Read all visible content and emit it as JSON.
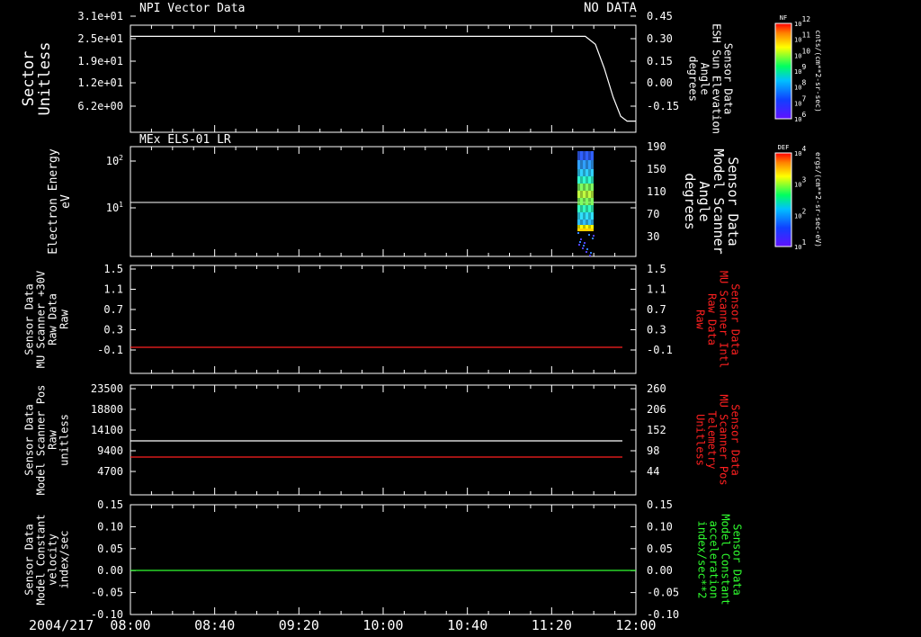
{
  "colors": {
    "bg": "#000000",
    "fg": "#ffffff",
    "red": "#ff2020",
    "green": "#30ff30"
  },
  "header": {
    "left": "NPI Vector Data",
    "right": "NO DATA"
  },
  "panels": [
    {
      "id": "p1",
      "title": "NPI Vector Data",
      "left_label": [
        "Sector",
        "Unitless"
      ],
      "right_label": [
        "Sensor Data",
        "ESH Sun Elevation",
        "Angle",
        "degrees"
      ],
      "right_color": "fg",
      "left_ticks": [
        "3.1e+01",
        "2.5e+01",
        "1.9e+01",
        "1.2e+01",
        "6.2e+00"
      ],
      "right_ticks": [
        "0.45",
        "0.30",
        "0.15",
        "0.00",
        "-0.15"
      ]
    },
    {
      "id": "p2",
      "title": "MEx ELS-01 LR",
      "left_label": [
        "Electron Energy",
        "eV"
      ],
      "right_label": [
        "Sensor Data",
        "Model Scanner",
        "Angle",
        "degrees"
      ],
      "right_color": "fg",
      "left_ticks": [
        "10^2",
        "10^1"
      ],
      "right_ticks": [
        "190",
        "150",
        "110",
        "70",
        "30"
      ]
    },
    {
      "id": "p3",
      "title": "",
      "left_label": [
        "Sensor Data",
        "MU Scanner +30V",
        "Raw Data",
        "Raw"
      ],
      "right_label": [
        "Sensor Data",
        "MU Scanner Intl",
        "Raw Data",
        "Raw"
      ],
      "right_color": "red",
      "left_ticks": [
        "1.5",
        "1.1",
        "0.7",
        "0.3",
        "-0.1"
      ],
      "right_ticks": [
        "1.5",
        "1.1",
        "0.7",
        "0.3",
        "-0.1"
      ]
    },
    {
      "id": "p4",
      "title": "",
      "left_label": [
        "Sensor Data",
        "Model Scanner Pos",
        "Raw",
        "unitless"
      ],
      "right_label": [
        "Sensor Data",
        "MU Scanner Pos",
        "Telemetry",
        "Unitless"
      ],
      "right_color": "red",
      "left_ticks": [
        "23500",
        "18800",
        "14100",
        "9400",
        "4700"
      ],
      "right_ticks": [
        "260",
        "206",
        "152",
        "98",
        "44"
      ]
    },
    {
      "id": "p5",
      "title": "",
      "left_label": [
        "Sensor Data",
        "Model Constant",
        "velocity",
        "index/sec"
      ],
      "right_label": [
        "Sensor Data",
        "Model Constant",
        "acceleration",
        "index/sec**2"
      ],
      "right_color": "green",
      "left_ticks": [
        "0.15",
        "0.10",
        "0.05",
        "0.00",
        "-0.05",
        "-0.10"
      ],
      "right_ticks": [
        "0.15",
        "0.10",
        "0.05",
        "0.00",
        "-0.05",
        "-0.10"
      ]
    }
  ],
  "colorbars": [
    {
      "tag": "NF",
      "units": "cnts/(cm**2-sr-sec)",
      "ticks": [
        "10^12",
        "10^11",
        "10^10",
        "10^9",
        "10^8",
        "10^7",
        "10^6"
      ]
    },
    {
      "tag": "DEF",
      "units": "ergs/(cm**2-sr-sec-eV)",
      "ticks": [
        "10^4",
        "10^3",
        "10^2",
        "10^1"
      ]
    }
  ],
  "time_axis": {
    "date": "2004/217",
    "ticks": [
      "08:00",
      "08:40",
      "09:20",
      "10:00",
      "10:40",
      "11:20",
      "12:00"
    ]
  },
  "chart_data": [
    {
      "type": "line",
      "panel": "p1",
      "series": [
        {
          "values_x_hours": [
            8.0,
            11.6,
            11.72,
            11.85,
            11.92,
            12.0
          ],
          "values": [
            0.38,
            0.38,
            0.25,
            0.0,
            -0.15,
            -0.15
          ]
        }
      ],
      "xlim": [
        "08:00",
        "12:00"
      ],
      "ylim": [
        -0.22,
        0.45
      ]
    },
    {
      "type": "heatmap",
      "panel": "p2",
      "x_range": [
        "11:28",
        "11:35"
      ],
      "y_range_eV": [
        2,
        170
      ],
      "line_value": 14
    },
    {
      "type": "line",
      "panel": "p3",
      "series": [
        {
          "color": "red",
          "values": [
            0.0
          ]
        }
      ],
      "ylim": [
        -0.3,
        1.5
      ]
    },
    {
      "type": "line",
      "panel": "p4",
      "series": [
        {
          "color": "fg",
          "values": [
            11300
          ]
        },
        {
          "color": "red",
          "values": [
            8200
          ]
        }
      ],
      "ylim": [
        1000,
        23500
      ]
    },
    {
      "type": "line",
      "panel": "p5",
      "series": [
        {
          "color": "green",
          "values": [
            0.0
          ]
        }
      ],
      "ylim": [
        -0.1,
        0.15
      ]
    }
  ]
}
